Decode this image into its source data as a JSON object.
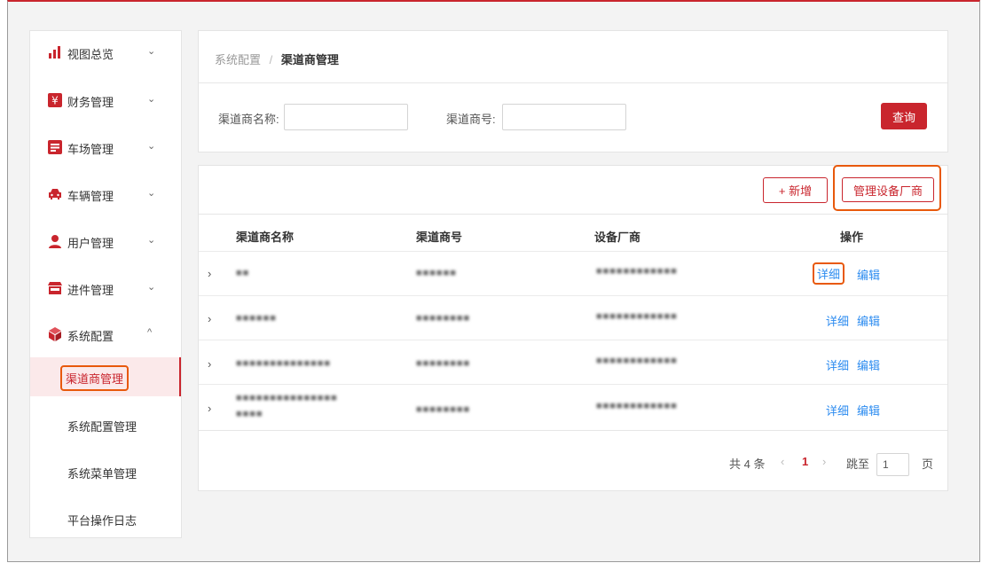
{
  "colors": {
    "brand": "#c9252d",
    "link": "#2d8cf0",
    "highlight": "#e8590c"
  },
  "sidebar": {
    "items": [
      {
        "label": "视图总览",
        "icon": "bar-chart-icon",
        "chevron": "⌄"
      },
      {
        "label": "财务管理",
        "icon": "yen-icon",
        "chevron": "⌄"
      },
      {
        "label": "车场管理",
        "icon": "list-icon",
        "chevron": "⌄"
      },
      {
        "label": "车辆管理",
        "icon": "car-icon",
        "chevron": "⌄"
      },
      {
        "label": "用户管理",
        "icon": "user-icon",
        "chevron": "⌄"
      },
      {
        "label": "进件管理",
        "icon": "store-icon",
        "chevron": "⌄"
      },
      {
        "label": "系统配置",
        "icon": "cube-icon",
        "chevron": "^"
      }
    ],
    "subitems": [
      {
        "label": "渠道商管理",
        "active": true
      },
      {
        "label": "系统配置管理"
      },
      {
        "label": "系统菜单管理"
      },
      {
        "label": "平台操作日志"
      }
    ]
  },
  "breadcrumb": {
    "parent": "系统配置",
    "separator": "/",
    "current": "渠道商管理"
  },
  "search": {
    "name_label": "渠道商名称:",
    "name_value": "",
    "code_label": "渠道商号:",
    "code_value": "",
    "query_button": "查询"
  },
  "toolbar": {
    "add_button": "+ 新增",
    "manage_vendor_button": "管理设备厂商"
  },
  "table": {
    "columns": [
      "渠道商名称",
      "渠道商号",
      "设备厂商",
      "操作"
    ],
    "rows": [
      {
        "name": "■■",
        "code": "■■■■■■",
        "vendor": "■■■■■■■■■■■■",
        "detail": "详细",
        "edit": "编辑"
      },
      {
        "name": "■■■■■■",
        "code": "■■■■■■■■",
        "vendor": "■■■■■■■■■■■■",
        "detail": "详细",
        "edit": "编辑"
      },
      {
        "name": "■■■■■■■■■■■■■■",
        "code": "■■■■■■■■",
        "vendor": "■■■■■■■■■■■■",
        "detail": "详细",
        "edit": "编辑"
      },
      {
        "name": "■■■■■■■■■■■■■■■",
        "name2": "■■■■",
        "code": "■■■■■■■■",
        "vendor": "■■■■■■■■■■■■",
        "detail": "详细",
        "edit": "编辑"
      }
    ]
  },
  "pagination": {
    "total": "共 4 条",
    "prev": "‹",
    "current_page": "1",
    "next": "›",
    "goto_label": "跳至",
    "goto_value": "1",
    "page_unit": "页"
  }
}
